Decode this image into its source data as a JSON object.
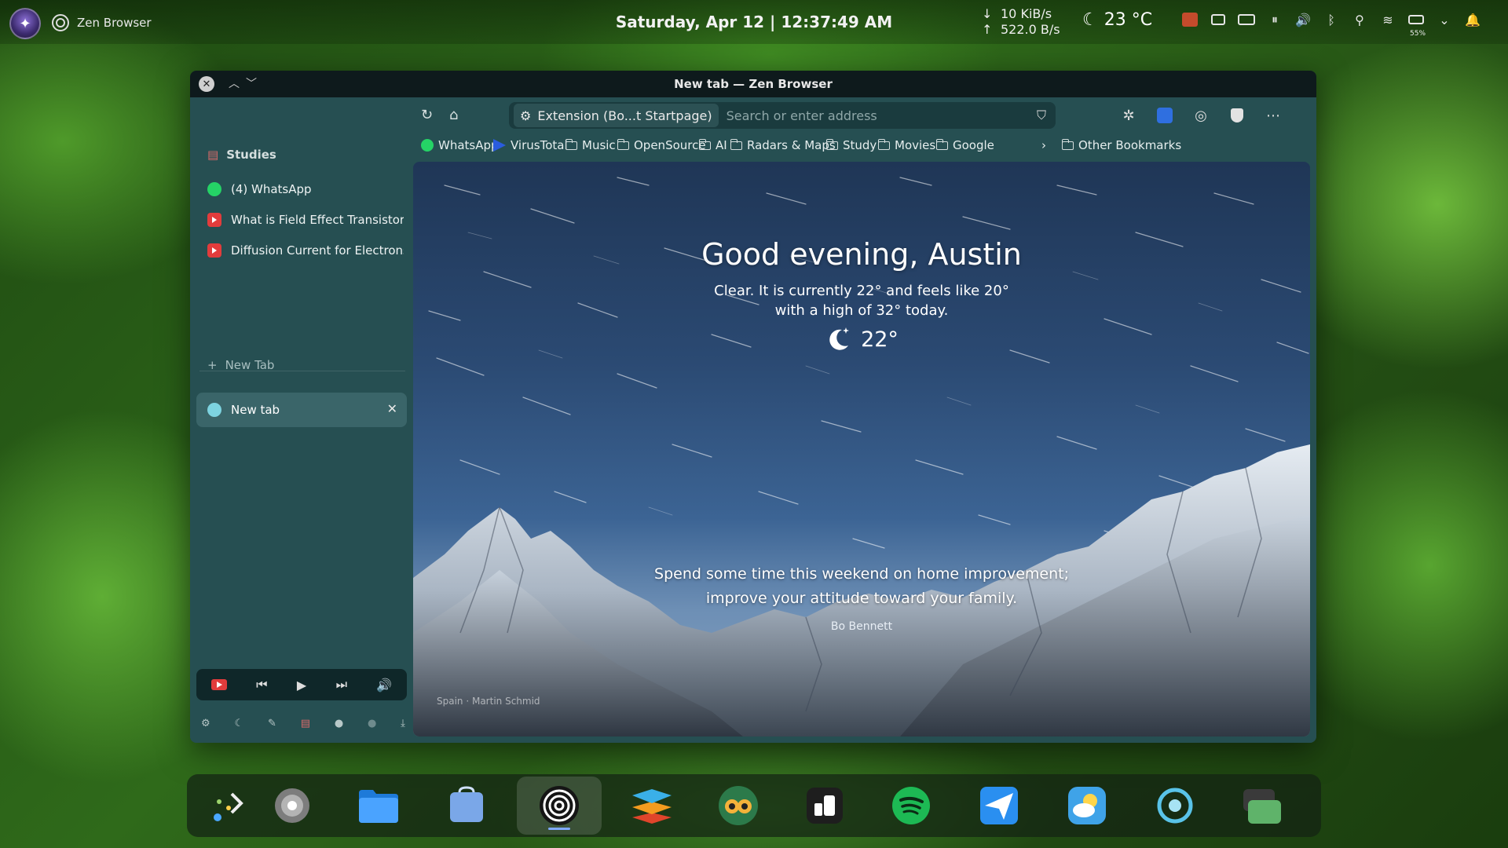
{
  "panel": {
    "app_name": "Zen Browser",
    "clock": "Saturday, Apr 12 | 12:37:49 AM",
    "net_down": "10 KiB/s",
    "net_up": "522.0 B/s",
    "temperature": "23 °C",
    "battery_pct": "55%"
  },
  "window": {
    "title": "New tab — Zen Browser"
  },
  "sidebar": {
    "workspace": "Studies",
    "tabs": [
      {
        "label": "(4) WhatsApp",
        "icon": "whatsapp-icon"
      },
      {
        "label": "What is Field Effect Transistor",
        "icon": "youtube-icon"
      },
      {
        "label": "Diffusion Current for Electrons",
        "icon": "youtube-icon"
      }
    ],
    "new_tab_label": "New Tab",
    "active_tab_label": "New tab"
  },
  "toolbar": {
    "url_extension": "Extension (Bo...t Startpage)",
    "url_placeholder": "Search or enter address"
  },
  "bookmarks": {
    "items": [
      "WhatsApp",
      "VirusTotal",
      "Music",
      "OpenSource",
      "AI",
      "Radars & Maps",
      "Study",
      "Movies",
      "Google"
    ],
    "other": "Other Bookmarks"
  },
  "startpage": {
    "greeting": "Good evening, Austin",
    "weather_line1": "Clear. It is currently 22° and feels like 20°",
    "weather_line2": "with a high of 32° today.",
    "temp": "22°",
    "quote_line1": "Spend some time this weekend on home improvement;",
    "quote_line2": "improve your attitude toward your family.",
    "author": "Bo Bennett",
    "credit": "Spain · Martin Schmid"
  },
  "colors": {
    "sidebar_bg": "#264f52",
    "titlebar_bg": "#0e1a1c",
    "active_tab_bg": "#3a6569",
    "youtube_red": "#e23c3c",
    "whatsapp_green": "#25d366"
  }
}
